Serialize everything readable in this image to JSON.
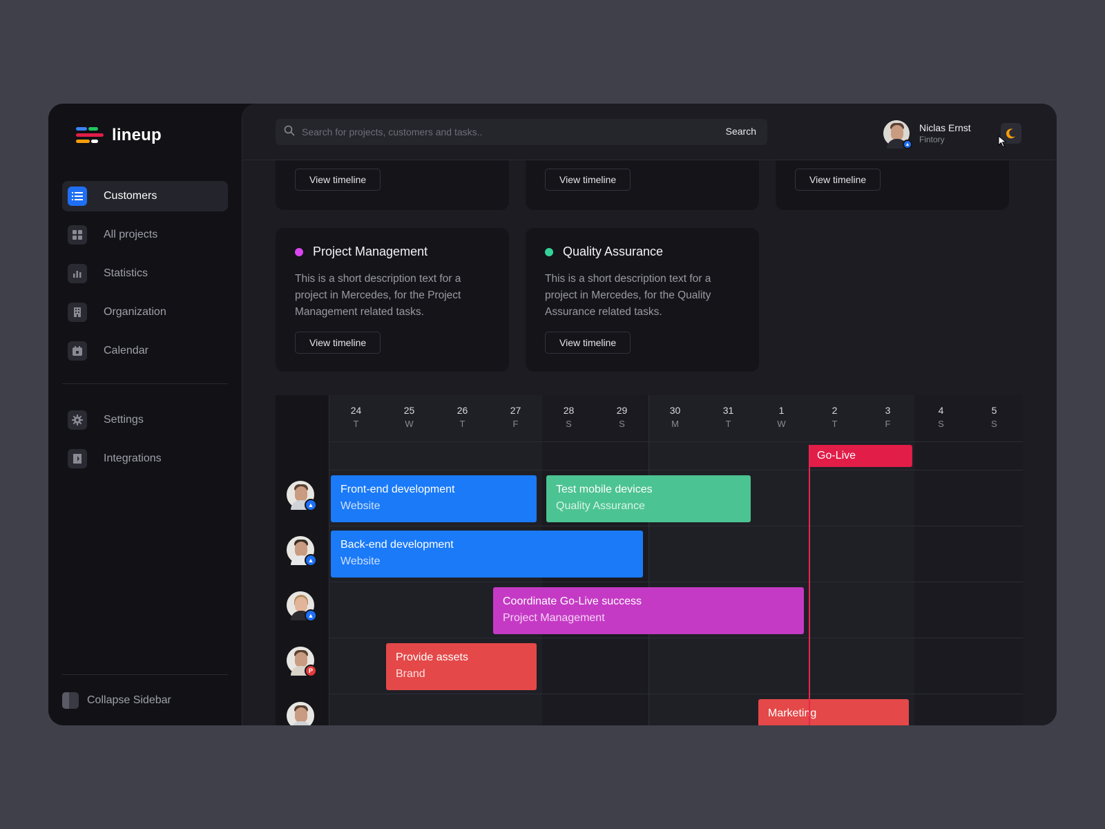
{
  "app": {
    "name": "lineup"
  },
  "sidebar": {
    "items": [
      {
        "label": "Customers",
        "icon": "list-icon",
        "active": true
      },
      {
        "label": "All projects",
        "icon": "grid-icon"
      },
      {
        "label": "Statistics",
        "icon": "bar-chart-icon"
      },
      {
        "label": "Organization",
        "icon": "building-icon"
      },
      {
        "label": "Calendar",
        "icon": "calendar-icon"
      }
    ],
    "secondary": [
      {
        "label": "Settings",
        "icon": "gear-icon"
      },
      {
        "label": "Integrations",
        "icon": "plug-icon"
      }
    ],
    "collapse_label": "Collapse Sidebar"
  },
  "topbar": {
    "search_placeholder": "Search for projects, customers and tasks..",
    "search_button": "Search",
    "user": {
      "name": "Niclas Ernst",
      "org": "Fintory"
    },
    "theme_icon": "moon-icon"
  },
  "cards_top": [
    {
      "button": "View timeline"
    },
    {
      "button": "View timeline"
    },
    {
      "button": "View timeline"
    }
  ],
  "cards": [
    {
      "title": "Project Management",
      "color": "#d946ef",
      "description": "This is a short description text for a project in Mercedes, for the Project Management related tasks.",
      "button": "View timeline"
    },
    {
      "title": "Quality Assurance",
      "color": "#34d399",
      "description": "This is a short description text for a project in Mercedes, for the Quality Assurance related tasks.",
      "button": "View timeline"
    }
  ],
  "timeline": {
    "days": [
      {
        "num": "24",
        "wd": "T"
      },
      {
        "num": "25",
        "wd": "W"
      },
      {
        "num": "26",
        "wd": "T"
      },
      {
        "num": "27",
        "wd": "F"
      },
      {
        "num": "28",
        "wd": "S"
      },
      {
        "num": "29",
        "wd": "S"
      },
      {
        "num": "30",
        "wd": "M"
      },
      {
        "num": "31",
        "wd": "T"
      },
      {
        "num": "1",
        "wd": "W"
      },
      {
        "num": "2",
        "wd": "T"
      },
      {
        "num": "3",
        "wd": "F"
      },
      {
        "num": "4",
        "wd": "S"
      },
      {
        "num": "5",
        "wd": "S"
      }
    ],
    "milestone": {
      "label": "Go-Live",
      "color": "#e11d48"
    },
    "tasks": [
      {
        "title": "Front-end development",
        "sub": "Website",
        "color": "#1a7af8",
        "sub_color": "#cfe1ff"
      },
      {
        "title": "Test mobile devices",
        "sub": "Quality Assurance",
        "color": "#4cc392",
        "sub_color": "#d6f5e8"
      },
      {
        "title": "Back-end development",
        "sub": "Website",
        "color": "#1a7af8",
        "sub_color": "#cfe1ff"
      },
      {
        "title": "Coordinate Go-Live success",
        "sub": "Project Management",
        "color": "#c53ac5",
        "sub_color": "#f6d4f6"
      },
      {
        "title": "Provide assets",
        "sub": "Brand",
        "color": "#e44848",
        "sub_color": "#ffdede"
      },
      {
        "title": "Marketing",
        "sub": "",
        "color": "#e44848",
        "sub_color": "#ffdede"
      }
    ],
    "badges": [
      "mountain-icon",
      "mountain-icon",
      "mountain-icon",
      "P"
    ]
  }
}
